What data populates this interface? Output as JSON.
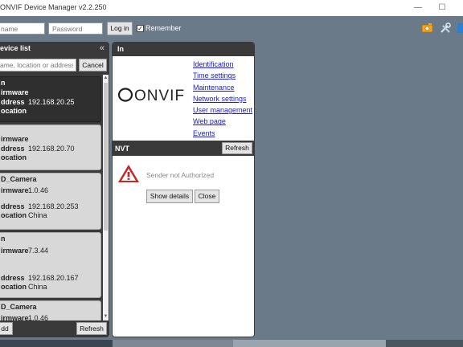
{
  "window": {
    "title": "ONVIF Device Manager v2.2.250",
    "min_glyph": "—",
    "max_glyph": "☐"
  },
  "toolbar": {
    "username_placeholder": "name",
    "password_placeholder": "Password",
    "login_label": "Log in",
    "remember_label": "Remember",
    "remember_checked": true,
    "icons": [
      "camera-refresh-icon",
      "tools-icon",
      "help-icon"
    ]
  },
  "device_list": {
    "title": "evice list",
    "collapse_glyph": "«",
    "filter_placeholder": "ame, location or address",
    "cancel_label": "Cancel",
    "add_label": "dd",
    "refresh_label": "Refresh",
    "labels": {
      "firmware": "irmware",
      "address": "ddress",
      "location": "ocation"
    },
    "devices": [
      {
        "name": "n",
        "firmware": "",
        "address": "192.168.20.25",
        "location": "",
        "selected": true
      },
      {
        "name": "",
        "firmware": "",
        "address": "192.168.20.70",
        "location": "",
        "selected": false
      },
      {
        "name": "D_Camera",
        "firmware": "1.0.46",
        "address": "192.168.20.253",
        "location": "China",
        "selected": false
      },
      {
        "name": "n",
        "firmware": "7.3.44",
        "address": "192.168.20.167",
        "location": "China",
        "selected": false
      },
      {
        "name": "D_Camera",
        "firmware": "1.0.46",
        "address": "",
        "location": "",
        "selected": false
      }
    ]
  },
  "info_panel": {
    "title": "In",
    "logo_text": "ONVIF",
    "links": [
      "Identification",
      "Time settings",
      "Maintenance",
      "Network settings",
      "User management",
      "Web page",
      "Events"
    ],
    "nvt_title": "NVT",
    "nvt_refresh_label": "Refresh",
    "error_message": "Sender not Authorized",
    "show_details_label": "Show details",
    "close_label": "Close"
  },
  "colors": {
    "accent_link": "#1a1ad6",
    "warning": "#c0282b",
    "panel_dark": "#3a3a3a",
    "background": "#6b7a89"
  }
}
